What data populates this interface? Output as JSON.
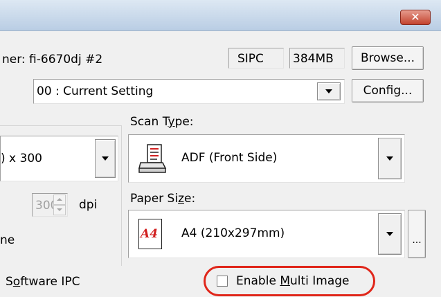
{
  "window": {
    "close_glyph": "✕"
  },
  "scanner": {
    "label_partial": "ner: fi-6670dj #2",
    "badge_ipc": "SIPC",
    "badge_memory": "384MB",
    "browse_label": "Browse..."
  },
  "setting": {
    "value": "00 : Current Setting",
    "config_label": "Config..."
  },
  "resolution": {
    "value_partial": ") x 300",
    "custom_value": "300",
    "unit": "dpi",
    "partial_label": "ne"
  },
  "scan_type": {
    "label_prefix": "Scan T",
    "label_mnemonic": "y",
    "label_suffix": "pe:",
    "value": "ADF (Front Side)",
    "icon": "adf-scanner-icon"
  },
  "paper_size": {
    "label_prefix": "Paper Si",
    "label_mnemonic": "z",
    "label_suffix": "e:",
    "value": "A4 (210x297mm)",
    "icon_text": "A4",
    "more_label": "..."
  },
  "software_ipc": {
    "label_prefix": "S",
    "label_mnemonic": "o",
    "label_suffix": "ftware IPC"
  },
  "multi_image": {
    "label_prefix": "Enable ",
    "label_mnemonic": "M",
    "label_suffix": "ulti Image",
    "checked": false
  },
  "colors": {
    "highlight_ring": "#e0261a",
    "icon_red": "#d11f1f",
    "titlebar": "#c7d7ea"
  }
}
